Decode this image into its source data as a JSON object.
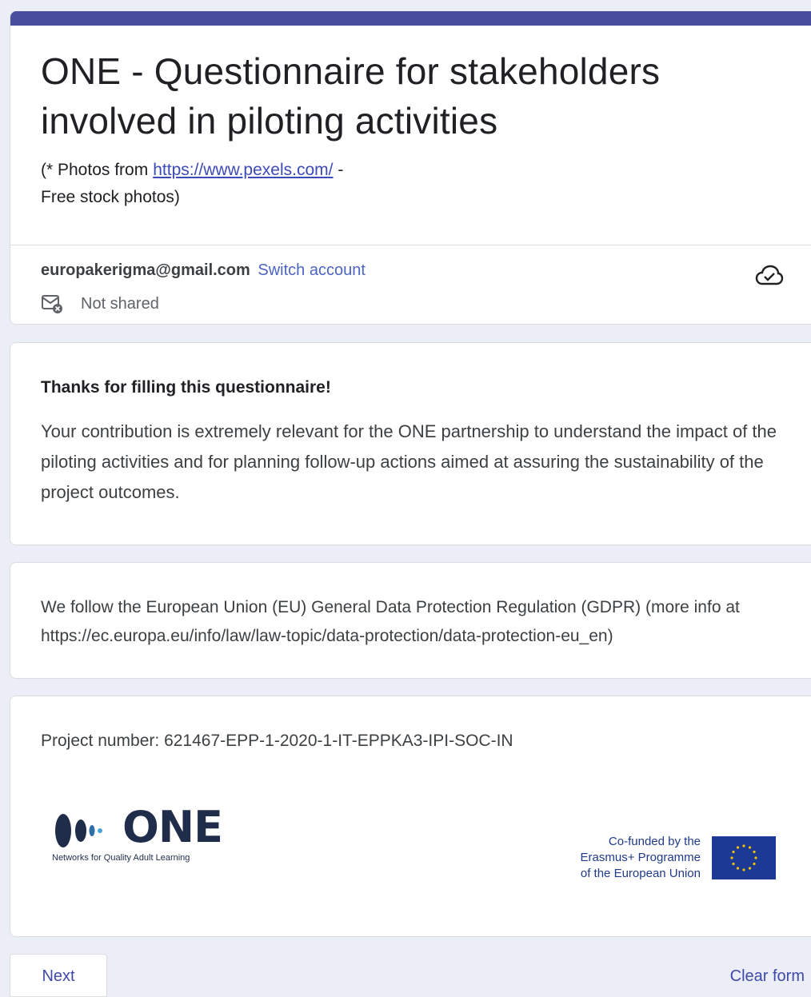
{
  "header": {
    "title_line1": "ONE - Questionnaire for stakeholders",
    "title_line2": "involved in piloting activities",
    "desc_prefix": "(* Photos from",
    "desc_link": "https://www.pexels.com/",
    "desc_suffix": "-",
    "desc_line2": "Free stock photos)",
    "accent_color": "#4a4e9f"
  },
  "account": {
    "email": "europakerigma@gmail.com",
    "switch_label": "Switch account",
    "shared_status": "Not shared",
    "icons": [
      "mail-not-shared-icon",
      "cloud-saved-icon"
    ]
  },
  "thanks": {
    "heading": "Thanks for filling this questionnaire!",
    "body": "Your contribution is extremely relevant for the ONE partnership to understand the impact of the piloting activities and for planning follow-up actions aimed at assuring the sustainability of the project outcomes."
  },
  "gdpr": {
    "text": "We follow the European Union (EU) General Data Protection Regulation (GDPR) (more info at  https://ec.europa.eu/info/law/law-topic/data-protection/data-protection-eu_en)"
  },
  "project": {
    "number_text": "Project number: 621467-EPP-1-2020-1-IT-EPPKA3-IPI-SOC-IN",
    "logo_word": "ONE",
    "logo_tagline": "Networks for Quality Adult Learning",
    "eu_line1": "Co-funded by the",
    "eu_line2": "Erasmus+ Programme",
    "eu_line3": "of the European Union"
  },
  "footer": {
    "next_label": "Next",
    "clear_label": "Clear form"
  }
}
